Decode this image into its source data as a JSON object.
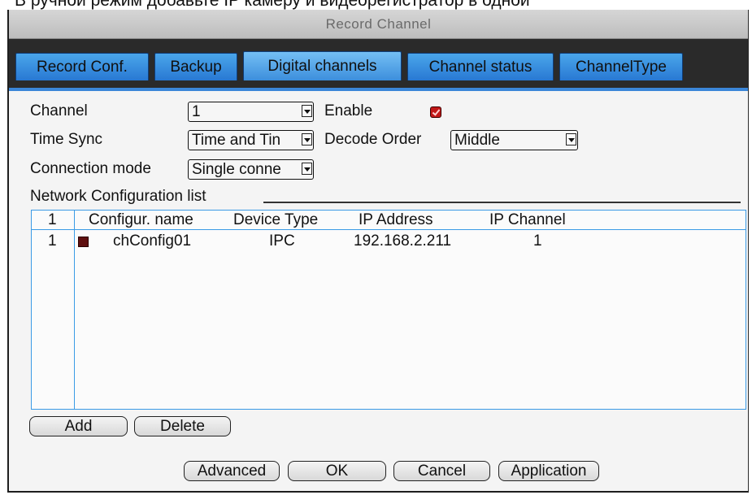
{
  "caption": {
    "text": "В ручной режим добавьте IP камеру и видеорегистратор в одной"
  },
  "window": {
    "title": "Record Channel"
  },
  "tabs": [
    {
      "label": "Record Conf."
    },
    {
      "label": "Backup"
    },
    {
      "label": "Digital channels",
      "active": true
    },
    {
      "label": "Channel status"
    },
    {
      "label": "ChannelType"
    }
  ],
  "form": {
    "channel_label": "Channel",
    "channel_value": "1",
    "enable_label": "Enable",
    "enable_checked": true,
    "time_sync_label": "Time Sync",
    "time_sync_value": "Time and Tin",
    "decode_order_label": "Decode Order",
    "decode_order_value": "Middle",
    "connection_mode_label": "Connection mode",
    "connection_mode_value": "Single conne"
  },
  "network_list": {
    "group_title": "Network Configuration list",
    "columns": {
      "index": "1",
      "name": "Configur. name",
      "device_type": "Device Type",
      "ip_address": "IP Address",
      "ip_channel": "IP Channel"
    },
    "rows": [
      {
        "index": "1",
        "name": "chConfig01",
        "device_type": "IPC",
        "ip_address": "192.168.2.211",
        "ip_channel": "1"
      }
    ]
  },
  "buttons": {
    "add": "Add",
    "delete": "Delete",
    "advanced": "Advanced",
    "ok": "OK",
    "cancel": "Cancel",
    "application": "Application"
  },
  "colors": {
    "tab_blue": "#3c8edc",
    "list_border": "#3b9be6",
    "checkbox_red": "#c11818"
  }
}
